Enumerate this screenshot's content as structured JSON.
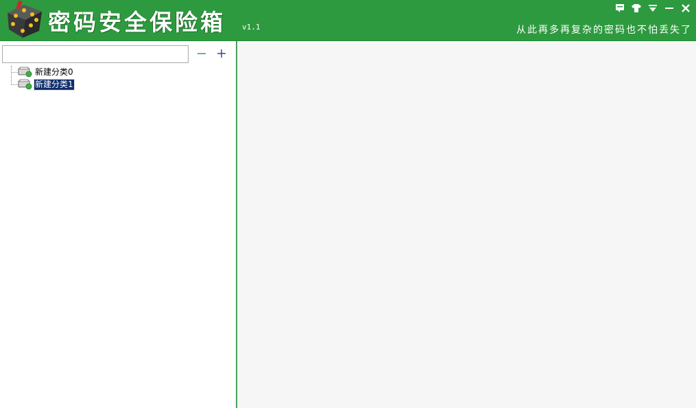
{
  "app": {
    "title": "密码安全保险箱",
    "version": "v1.1",
    "slogan": "从此再多再复杂的密码也不怕丢失了"
  },
  "window_controls": [
    {
      "name": "feedback-icon"
    },
    {
      "name": "skin-icon"
    },
    {
      "name": "menu-icon"
    },
    {
      "name": "minimize-icon"
    },
    {
      "name": "close-icon"
    }
  ],
  "search": {
    "value": "",
    "placeholder": ""
  },
  "toolbar": {
    "remove_icon": "minus-icon",
    "add_icon": "plus-icon"
  },
  "tree": {
    "items": [
      {
        "label": "新建分类0",
        "selected": false
      },
      {
        "label": "新建分类1",
        "selected": true
      }
    ]
  },
  "colors": {
    "titlebar": "#2e9a3f",
    "selection": "#0f2d6b",
    "divider": "#4aa05a"
  }
}
